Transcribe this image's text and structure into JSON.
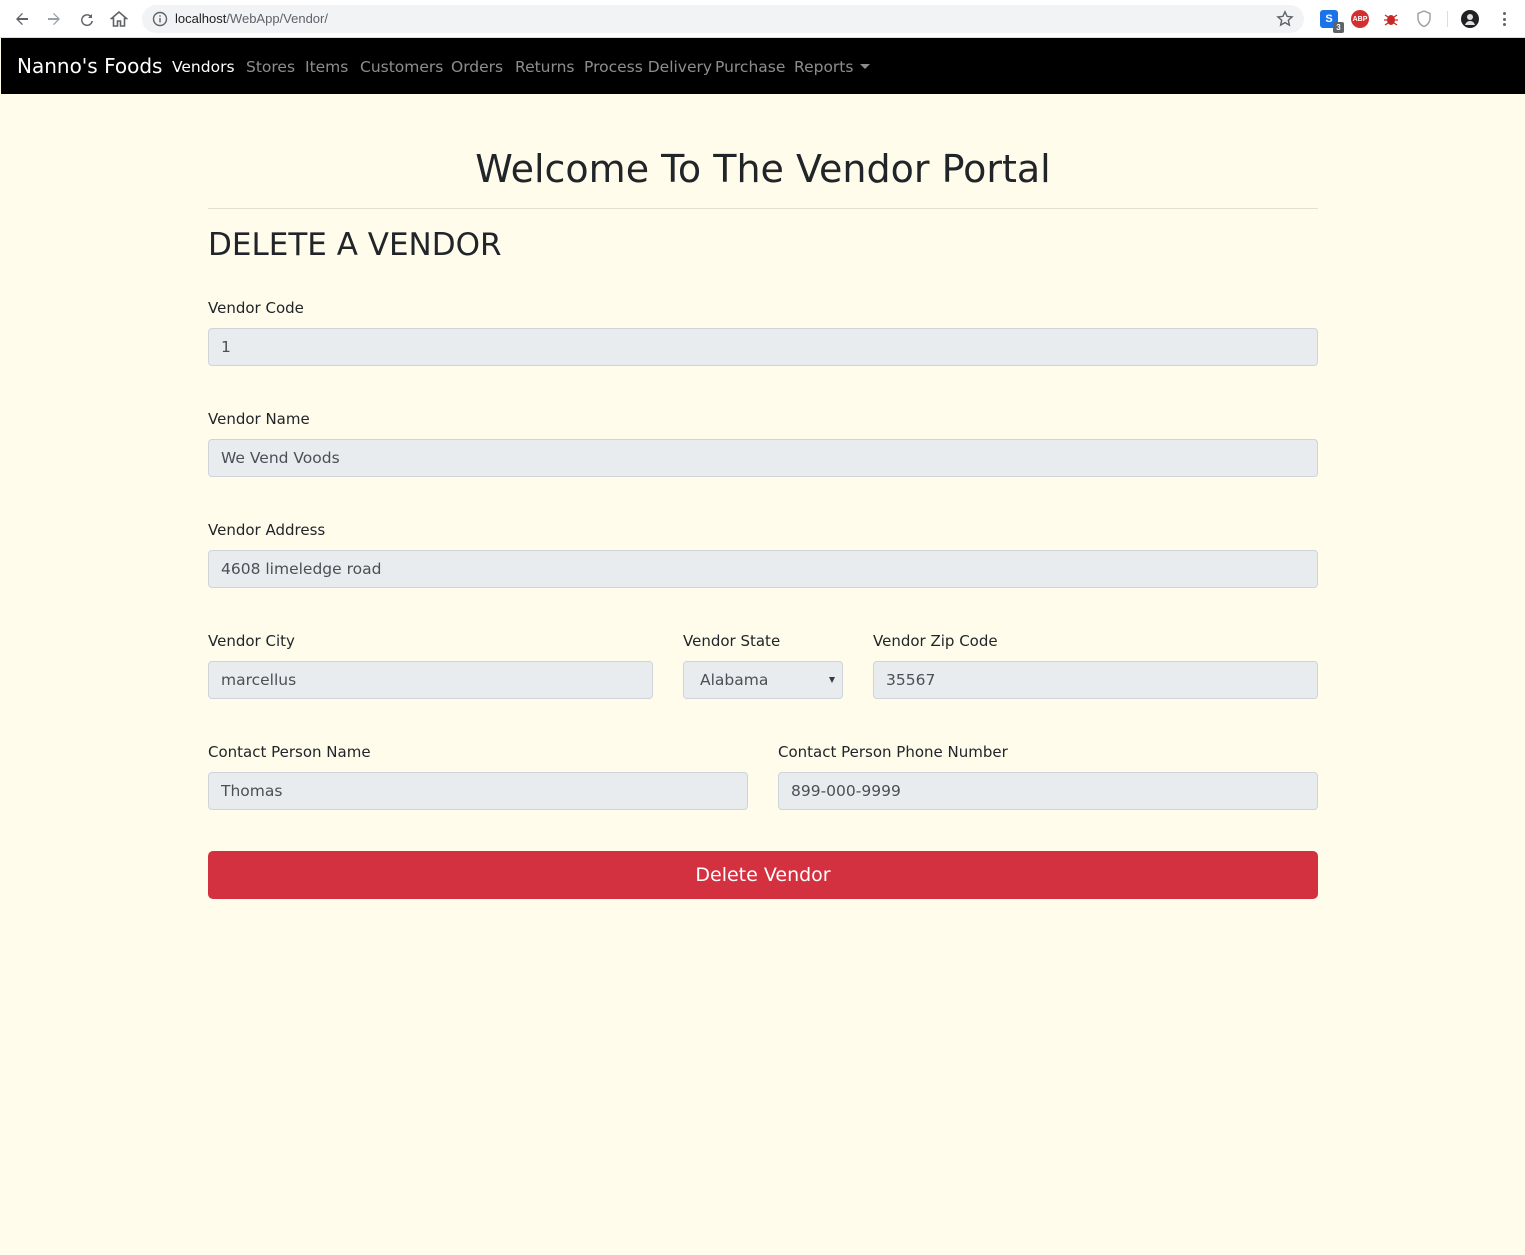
{
  "browser": {
    "url_host": "localhost",
    "url_path": "/WebApp/Vendor/",
    "extension_badge": "3",
    "extension_s_label": "S",
    "extension_abp_label": "ABP"
  },
  "navbar": {
    "brand": "Nanno's Foods",
    "items": [
      {
        "label": "Vendors",
        "active": true
      },
      {
        "label": "Stores"
      },
      {
        "label": "Items"
      },
      {
        "label": "Customers"
      },
      {
        "label": "Orders"
      },
      {
        "label": "Returns"
      },
      {
        "label": "Process Delivery"
      },
      {
        "label": "Purchase"
      },
      {
        "label": "Reports",
        "dropdown": true
      }
    ]
  },
  "page": {
    "title": "Welcome To The Vendor Portal",
    "section_title": "DELETE A VENDOR"
  },
  "form": {
    "vendor_code": {
      "label": "Vendor Code",
      "value": "1"
    },
    "vendor_name": {
      "label": "Vendor Name",
      "value": "We Vend Voods"
    },
    "vendor_address": {
      "label": "Vendor Address",
      "value": "4608 limeledge road"
    },
    "vendor_city": {
      "label": "Vendor City",
      "value": "marcellus"
    },
    "vendor_state": {
      "label": "Vendor State",
      "value": "Alabama"
    },
    "vendor_zip": {
      "label": "Vendor Zip Code",
      "value": "35567"
    },
    "contact_name": {
      "label": "Contact Person Name",
      "value": "Thomas"
    },
    "contact_phone": {
      "label": "Contact Person Phone Number",
      "value": "899-000-9999"
    },
    "submit_label": "Delete Vendor"
  },
  "colors": {
    "page_background": "#fffcec",
    "navbar_background": "#000000",
    "danger_button": "#d33040",
    "field_background": "#e9ecef"
  }
}
